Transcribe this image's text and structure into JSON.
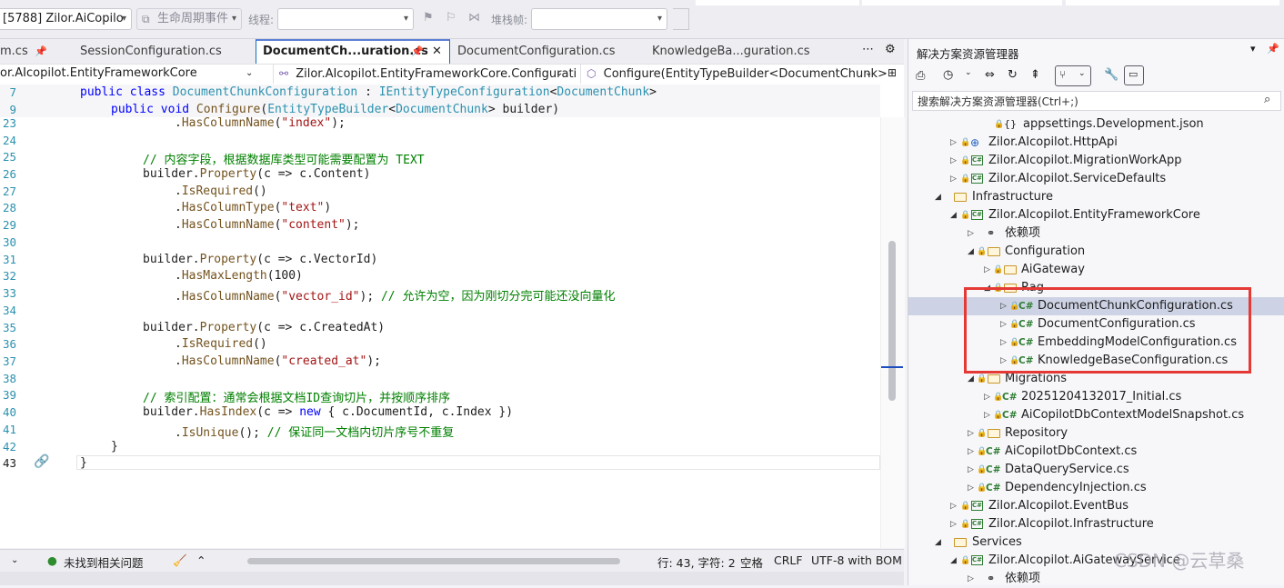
{
  "toolbar": {
    "process": "[5788] Zilor.AiCopilo",
    "lifecycle": "生命周期事件",
    "thread_label": "线程:",
    "stack_label": "堆栈帧:"
  },
  "tabs": [
    {
      "label": "m.cs"
    },
    {
      "label": "SessionConfiguration.cs"
    },
    {
      "label": "DocumentCh...uration.cs"
    },
    {
      "label": "DocumentConfiguration.cs"
    },
    {
      "label": "KnowledgeBa...guration.cs"
    }
  ],
  "nav": {
    "project": "or.AIcopilot.EntityFrameworkCore",
    "type": "Zilor.AIcopilot.EntityFrameworkCore.Configurati",
    "member": "Configure(EntityTypeBuilder<DocumentChunk>"
  },
  "code": {
    "ln7": "7",
    "ln9": "9",
    "ln23": "23",
    "ln24": "24",
    "ln25": "25",
    "ln26": "26",
    "ln27": "27",
    "ln28": "28",
    "ln29": "29",
    "ln30": "30",
    "ln31": "31",
    "ln32": "32",
    "ln33": "33",
    "ln34": "34",
    "ln35": "35",
    "ln36": "36",
    "ln37": "37",
    "ln38": "38",
    "ln39": "39",
    "ln40": "40",
    "ln41": "41",
    "ln42": "42",
    "ln43": "43",
    "l25_comment": "// 内容字段，根据数据库类型可能需要配置为 TEXT",
    "l33_comment": "// 允许为空，因为刚切分完可能还没向量化",
    "l39_comment": "// 索引配置：通常会根据文档ID查询切片，并按顺序排序",
    "l41_comment": "// 保证同一文档内切片序号不重复"
  },
  "status": {
    "issues": "未找到相关问题",
    "position": "行: 43, 字符: 2",
    "whitespace": "空格",
    "line_ending": "CRLF",
    "encoding": "UTF-8 with BOM"
  },
  "solution": {
    "title": "解决方案资源管理器",
    "search_placeholder": "搜索解决方案资源管理器(Ctrl+;)",
    "rows": [
      "appsettings.Development.json",
      "Zilor.AIcopilot.HttpApi",
      "Zilor.AIcopilot.MigrationWorkApp",
      "Zilor.AIcopilot.ServiceDefaults",
      "Infrastructure",
      "Zilor.AIcopilot.EntityFrameworkCore",
      "依赖项",
      "Configuration",
      "AiGateway",
      "Rag",
      "DocumentChunkConfiguration.cs",
      "DocumentConfiguration.cs",
      "EmbeddingModelConfiguration.cs",
      "KnowledgeBaseConfiguration.cs",
      "Migrations",
      "20251204132017_Initial.cs",
      "AiCopilotDbContextModelSnapshot.cs",
      "Repository",
      "AiCopilotDbContext.cs",
      "DataQueryService.cs",
      "DependencyInjection.cs",
      "Zilor.AIcopilot.EventBus",
      "Zilor.AIcopilot.Infrastructure",
      "Services",
      "Zilor.AIcopilot.AiGatewayService",
      "依赖项"
    ]
  },
  "watermark": "CSDN @云草桑",
  "colors": {
    "highlight_box": "#e53935",
    "selected_row": "#cdd3e4",
    "accent": "#0e70c0"
  }
}
